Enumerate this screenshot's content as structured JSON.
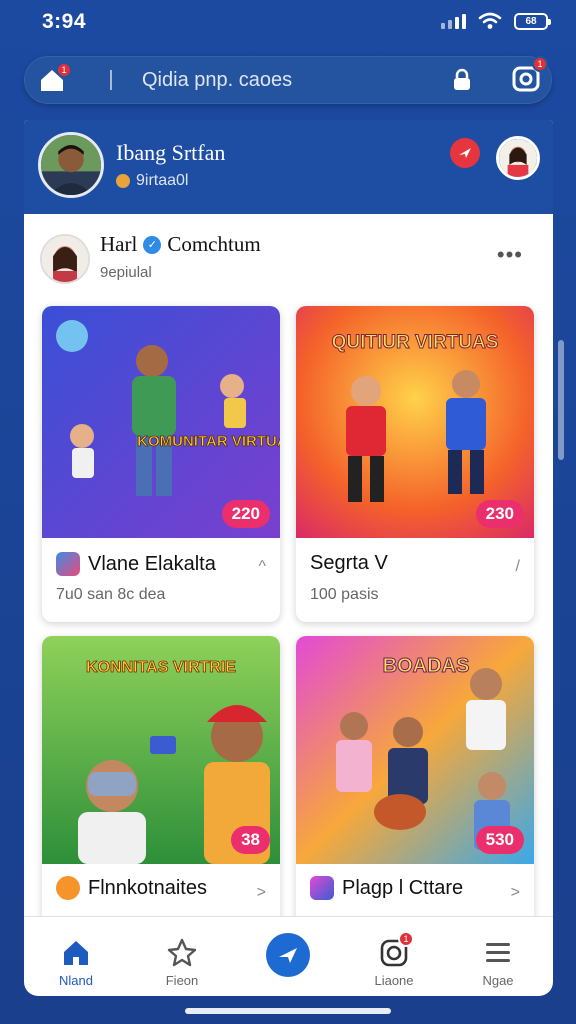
{
  "status": {
    "time": "3:94",
    "battery": "68"
  },
  "topbar": {
    "home_badge": "1",
    "search_text": "Qidia pnp. caoes",
    "camera_badge": "1"
  },
  "panel_header": {
    "name": "Ibang Srtfan",
    "subtitle": "9irtaa0l"
  },
  "post": {
    "author": "Harl",
    "author_suffix": "Comchtum",
    "subtitle": "9epiulal",
    "more": "•••"
  },
  "tiles": [
    {
      "overlay": "KOMUNITAR VIRTUAL",
      "badge": "220",
      "title": "Vlane Elakalta",
      "subtitle": "7u0 san 8c dea",
      "action": "^"
    },
    {
      "overlay": "QUITIUR VIRTUAS",
      "badge": "230",
      "title": "Segrta V",
      "subtitle": "100 pasis",
      "action": "/"
    },
    {
      "overlay": "KONNITAS VIRTRIE",
      "badge": "38",
      "title": "Flnnkotnaites",
      "subtitle": "",
      "action": ">"
    },
    {
      "overlay": "BOADAS",
      "badge": "530",
      "title": "Plagp l Cttare",
      "subtitle": "",
      "action": ">"
    }
  ],
  "bottom_nav": {
    "home": "Nland",
    "favorites": "Fieon",
    "notifications": "Liaone",
    "notif_badge": "1",
    "menu": "Ngae"
  },
  "colors": {
    "brand": "#1d4ea4",
    "accent_red": "#e5353e",
    "badge_pink": "#ea2f6c",
    "nav_active": "#1d5bbf"
  }
}
